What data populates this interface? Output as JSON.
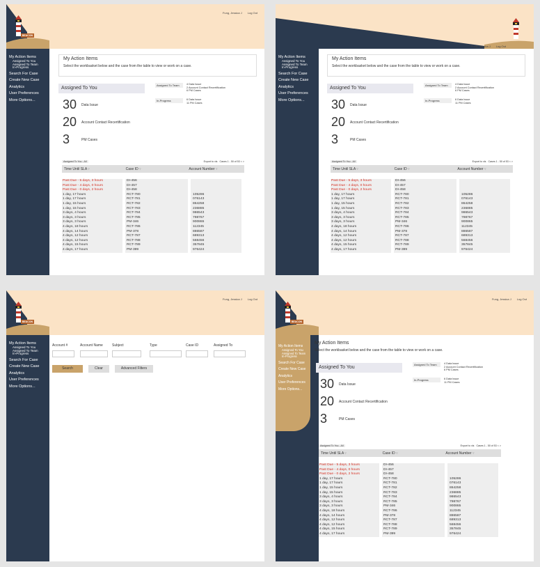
{
  "top_links": {
    "user": "Fung, Jessica J",
    "logout": "Log Out"
  },
  "logo_text": "BEACON",
  "colors": {
    "navy": "#2b3a4f",
    "cream": "#fbe3c6",
    "tan": "#c9a36a",
    "alert_red": "#d52b1e"
  },
  "nav": {
    "my_action_items": "My Action Items",
    "assigned_to_you": "Assigned To You",
    "assigned_to_team": "Assigned To Team",
    "in_progress": "In-Progress",
    "search_for_case": "Search For Case",
    "create_new_case": "Create New Case",
    "analytics": "Analytics",
    "user_preferences": "User Preferences",
    "more_options": "More Options..."
  },
  "header": {
    "title": "My Action Items",
    "subtitle": "Select the workbasket below and the case from the table to view or work on a case."
  },
  "assigned_to_you": {
    "title": "Assigned To You",
    "metrics": [
      {
        "count": "30",
        "label": "Data Issue"
      },
      {
        "count": "20",
        "label": "Account Contact Recertification"
      },
      {
        "count": "3",
        "label": "PM Cases"
      }
    ]
  },
  "team_metrics": [
    {
      "key": "Assigned To Team",
      "lines": [
        "4 Data Issue",
        "2 Account Contact Recertification",
        "6 PM Cases"
      ]
    },
    {
      "key": "In-Progress",
      "lines": [
        "6 Data Issue",
        "11 PM Cases"
      ]
    }
  ],
  "grid": {
    "filter": "Assigned To You - All",
    "export": "Export to xls",
    "paging": "Cases 1 - 50 of 53 < >",
    "columns": [
      "Time Until SLA",
      "Case ID",
      "Account Number"
    ],
    "rows": [
      {
        "sla": "Past Due - 5 days, 3 hours",
        "case": "DI-456",
        "account": "",
        "overdue": true
      },
      {
        "sla": "Past Due - 4 days, 0 hours",
        "case": "DI-457",
        "account": "",
        "overdue": true
      },
      {
        "sla": "Past Due - 0 days, 2 hours",
        "case": "DI-458",
        "account": "",
        "overdue": true
      },
      {
        "sla": "1 day, 17 hours",
        "case": "RCT-780",
        "account": "105286",
        "overdue": false
      },
      {
        "sla": "1 day, 17 hours",
        "case": "RCT-781",
        "account": "076143",
        "overdue": false
      },
      {
        "sla": "1 day, 15 hours",
        "case": "RCT-782",
        "account": "864258",
        "overdue": false
      },
      {
        "sla": "1 day, 15 hours",
        "case": "RCT-783",
        "account": "236885",
        "overdue": false
      },
      {
        "sla": "3 days, 4 hours",
        "case": "RCT-784",
        "account": "986543",
        "overdue": false
      },
      {
        "sla": "3 days, 3 hours",
        "case": "RCT-785",
        "account": "798767",
        "overdue": false
      },
      {
        "sla": "3 days, 3 hours",
        "case": "PM-346",
        "account": "900865",
        "overdue": false
      },
      {
        "sla": "4 days, 18 hours",
        "case": "RCT-786",
        "account": "112345",
        "overdue": false
      },
      {
        "sla": "4 days, 14 hours",
        "case": "PM-378",
        "account": "886587",
        "overdue": false
      },
      {
        "sla": "4 days, 12 hours",
        "case": "RCT-787",
        "account": "689313",
        "overdue": false
      },
      {
        "sla": "4 days, 12 hours",
        "case": "RCT-788",
        "account": "568456",
        "overdue": false
      },
      {
        "sla": "4 days, 15 hours",
        "case": "RCT-789",
        "account": "357845",
        "overdue": false
      },
      {
        "sla": "4 days, 17 hours",
        "case": "PM-399",
        "account": "976424",
        "overdue": false
      }
    ]
  },
  "search_form": {
    "fields": [
      "Account #",
      "Account Name",
      "Subject",
      "Type",
      "Case ID",
      "Assigned To"
    ],
    "search": "Search",
    "clear": "Clear",
    "advanced": "Advanced Filters"
  }
}
